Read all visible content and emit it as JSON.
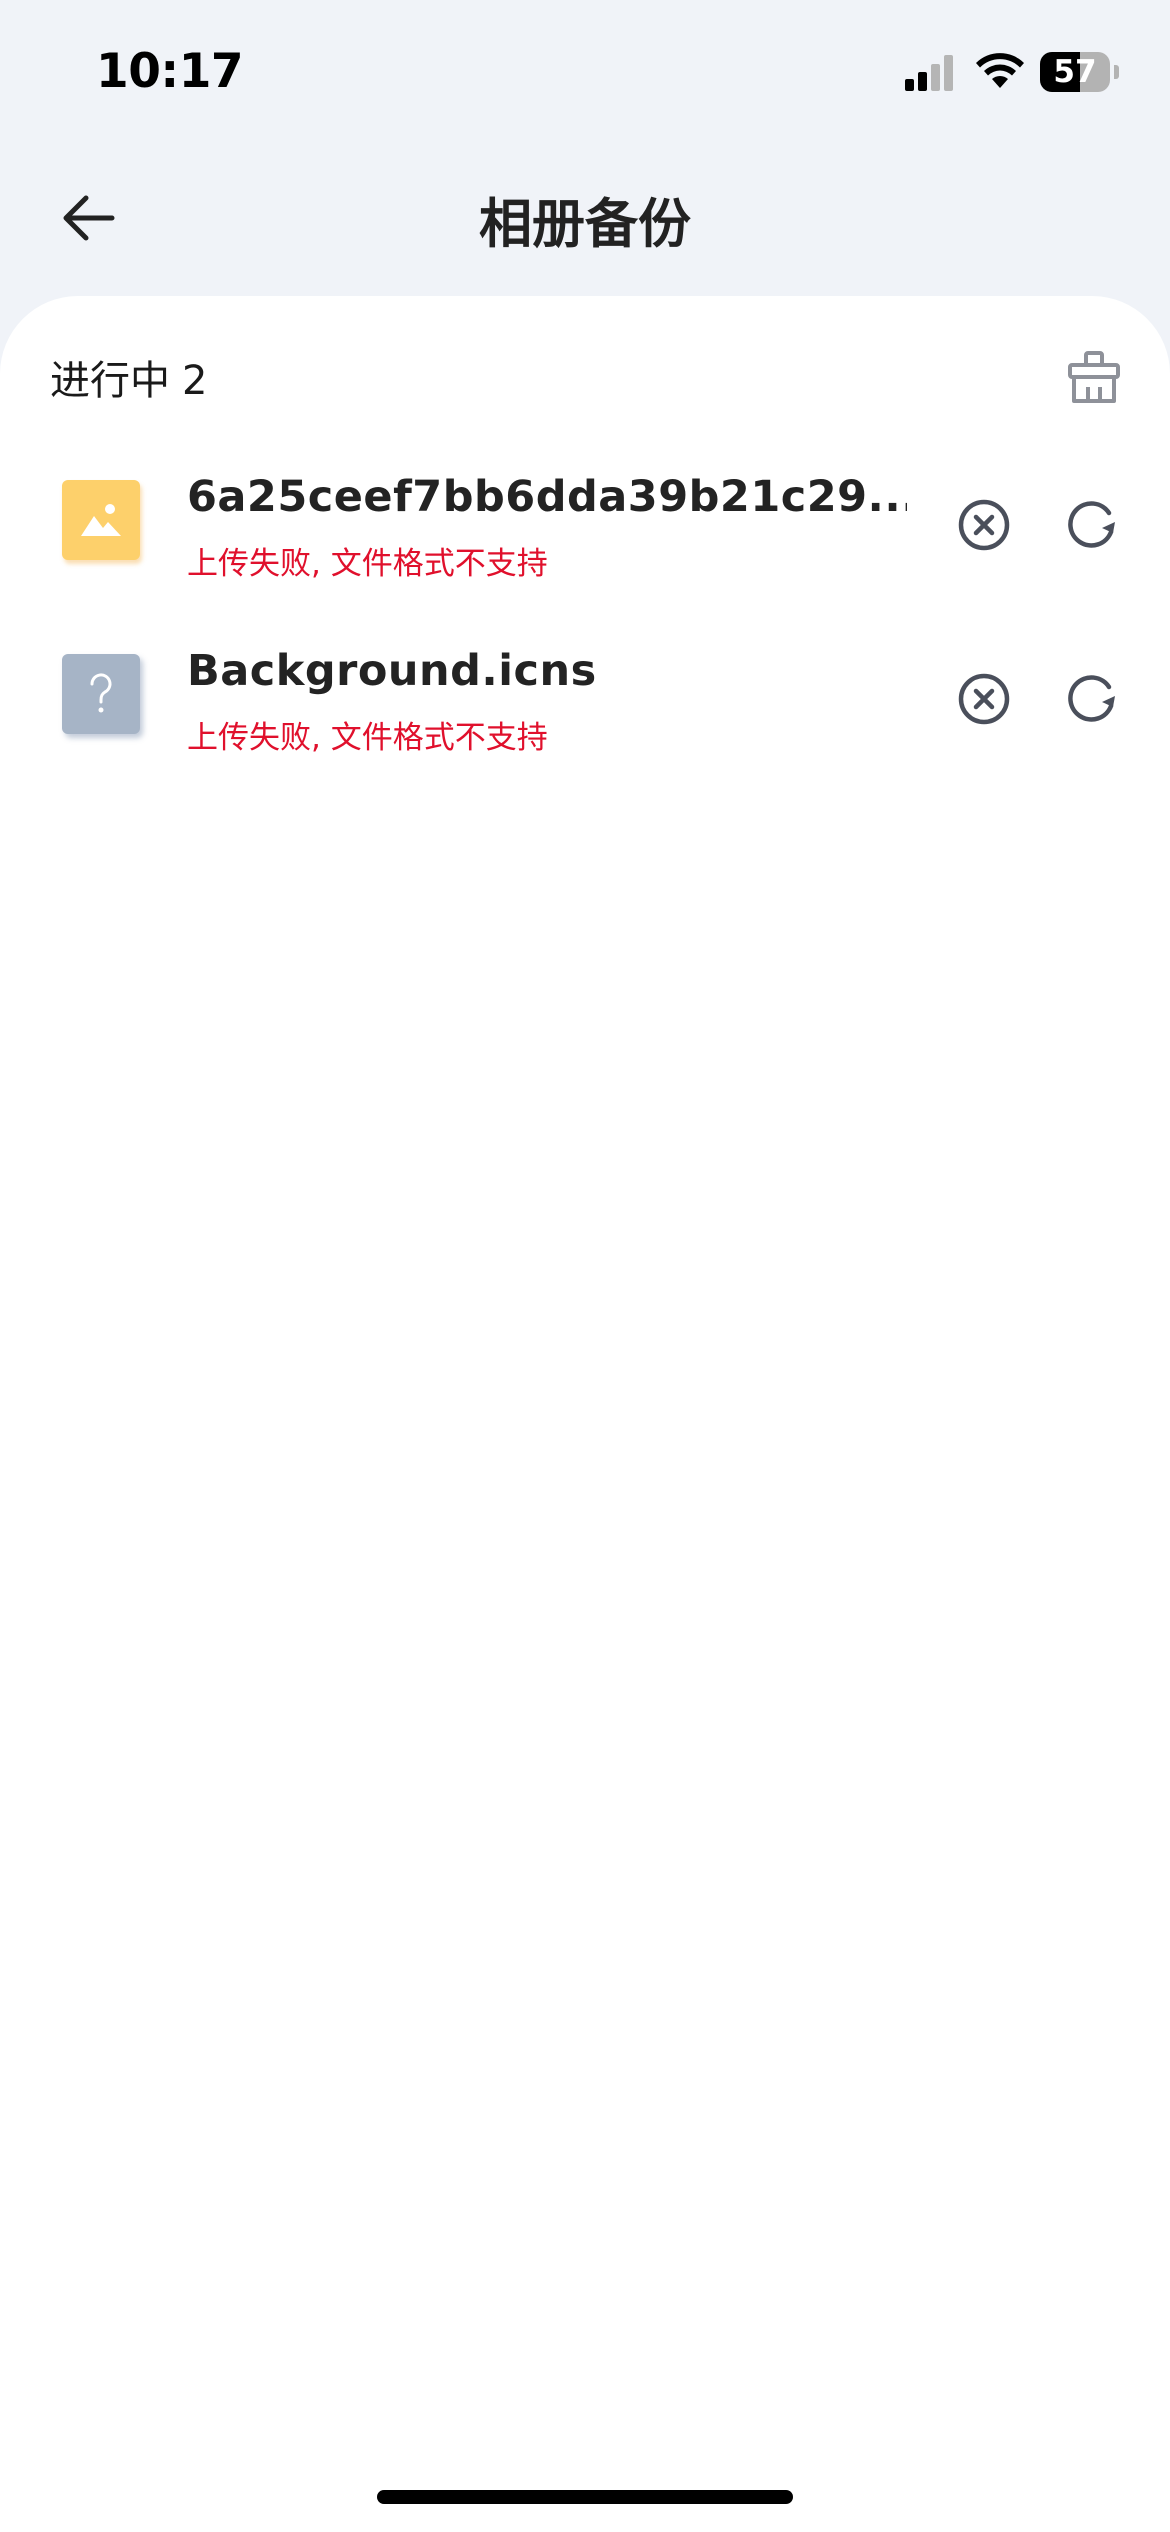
{
  "status_bar": {
    "time": "10:17",
    "battery_percent": 57,
    "battery_label": "57",
    "signal_bars_active": 2,
    "signal_bars_total": 4
  },
  "nav": {
    "back_icon": "arrow-left-icon",
    "title": "相册备份"
  },
  "section": {
    "label": "进行中",
    "count": "2",
    "clear_icon": "clear-broom-icon"
  },
  "files": [
    {
      "name": "6a25ceef7bb6dda39b21c29...",
      "status": "上传失败, 文件格式不支持",
      "thumb_type": "image",
      "thumb_icon": "image-file-icon"
    },
    {
      "name": "Background.icns",
      "status": "上传失败, 文件格式不支持",
      "thumb_type": "unknown",
      "thumb_icon": "unknown-file-icon"
    }
  ],
  "colors": {
    "background": "#f0f3f8",
    "card": "#ffffff",
    "error": "#e0102c",
    "icon": "#4a4f5b",
    "image_thumb": "#fdd06b",
    "unknown_thumb": "#a6b4c6"
  }
}
